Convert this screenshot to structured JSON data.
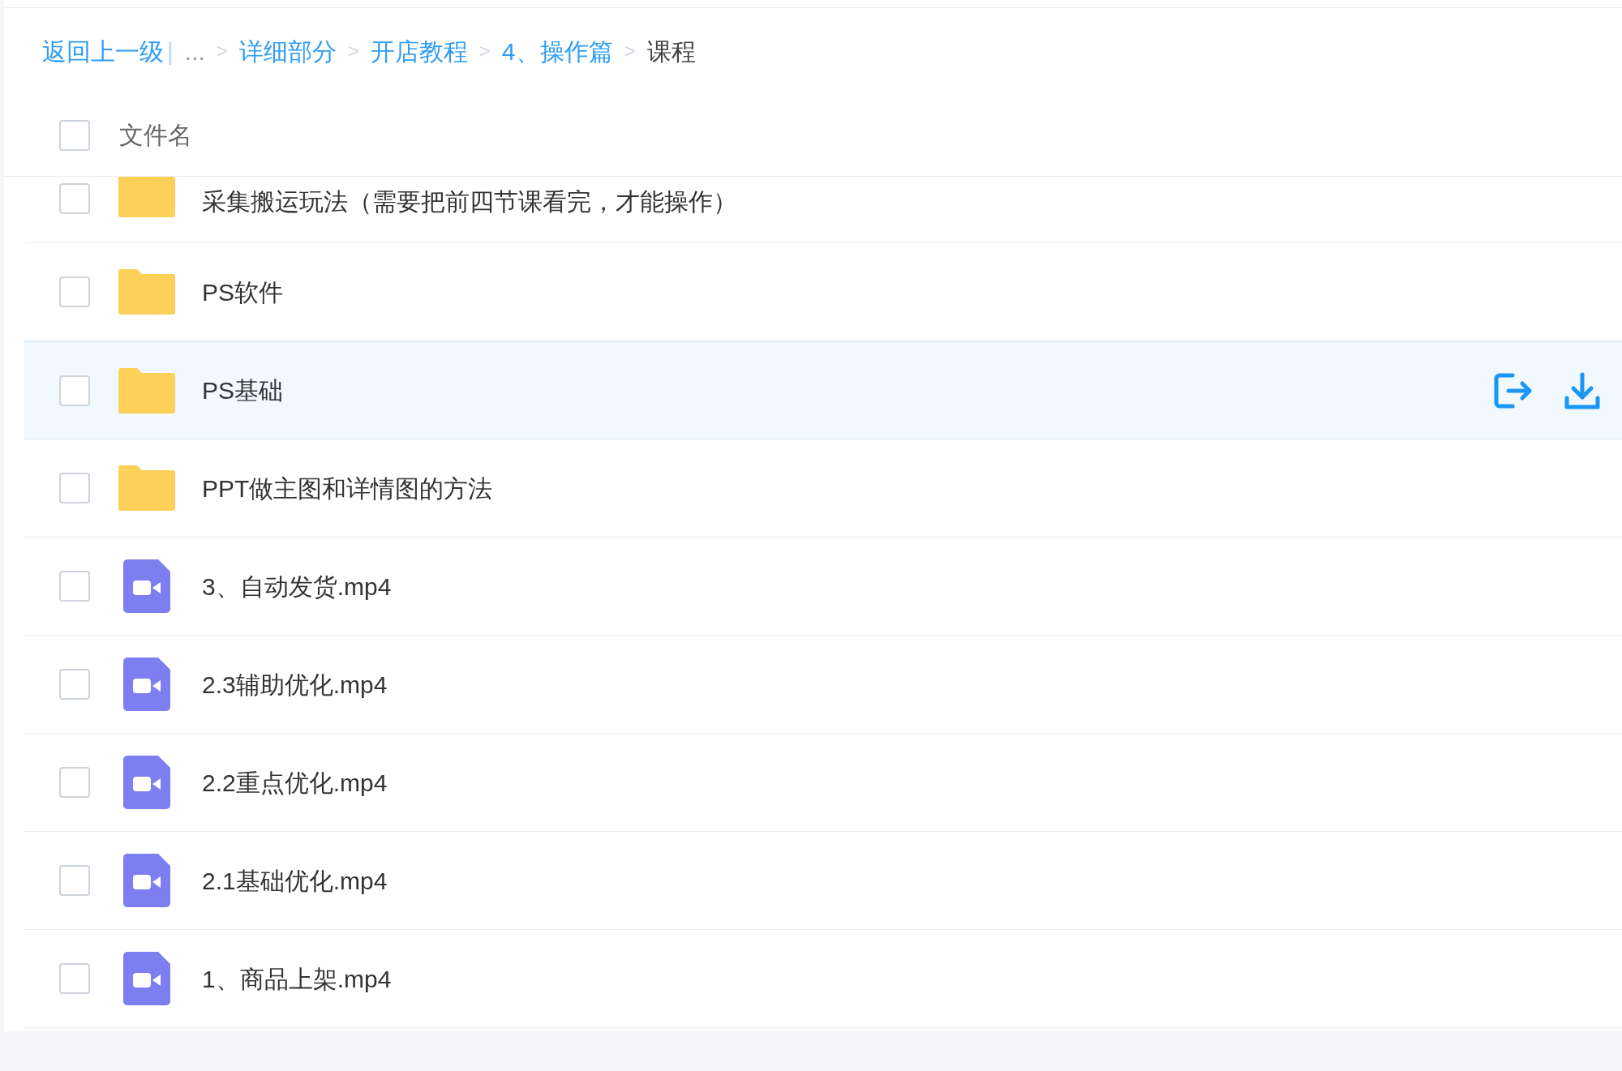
{
  "breadcrumb": [
    {
      "kind": "link",
      "text": "返回上一级"
    },
    {
      "kind": "divider",
      "text": "|"
    },
    {
      "kind": "ellipsis",
      "text": "..."
    },
    {
      "kind": "separator",
      "text": ">"
    },
    {
      "kind": "link",
      "text": "详细部分"
    },
    {
      "kind": "separator",
      "text": ">"
    },
    {
      "kind": "link",
      "text": "开店教程"
    },
    {
      "kind": "separator",
      "text": ">"
    },
    {
      "kind": "link",
      "text": "4、操作篇"
    },
    {
      "kind": "separator",
      "text": ">"
    },
    {
      "kind": "current",
      "text": "课程"
    }
  ],
  "header": {
    "label": "文件名",
    "checked": false
  },
  "rows": [
    {
      "kind": "folder",
      "name": "采集搬运玩法（需要把前四节课看完，才能操作）",
      "checked": false,
      "selected": false
    },
    {
      "kind": "folder",
      "name": "PS软件",
      "checked": false,
      "selected": false
    },
    {
      "kind": "folder",
      "name": "PS基础",
      "checked": false,
      "selected": true
    },
    {
      "kind": "folder",
      "name": "PPT做主图和详情图的方法",
      "checked": false,
      "selected": false
    },
    {
      "kind": "video",
      "name": "3、自动发货.mp4",
      "checked": false,
      "selected": false
    },
    {
      "kind": "video",
      "name": "2.3辅助优化.mp4",
      "checked": false,
      "selected": false
    },
    {
      "kind": "video",
      "name": "2.2重点优化.mp4",
      "checked": false,
      "selected": false
    },
    {
      "kind": "video",
      "name": "2.1基础优化.mp4",
      "checked": false,
      "selected": false
    },
    {
      "kind": "video",
      "name": "1、商品上架.mp4",
      "checked": false,
      "selected": false
    }
  ]
}
